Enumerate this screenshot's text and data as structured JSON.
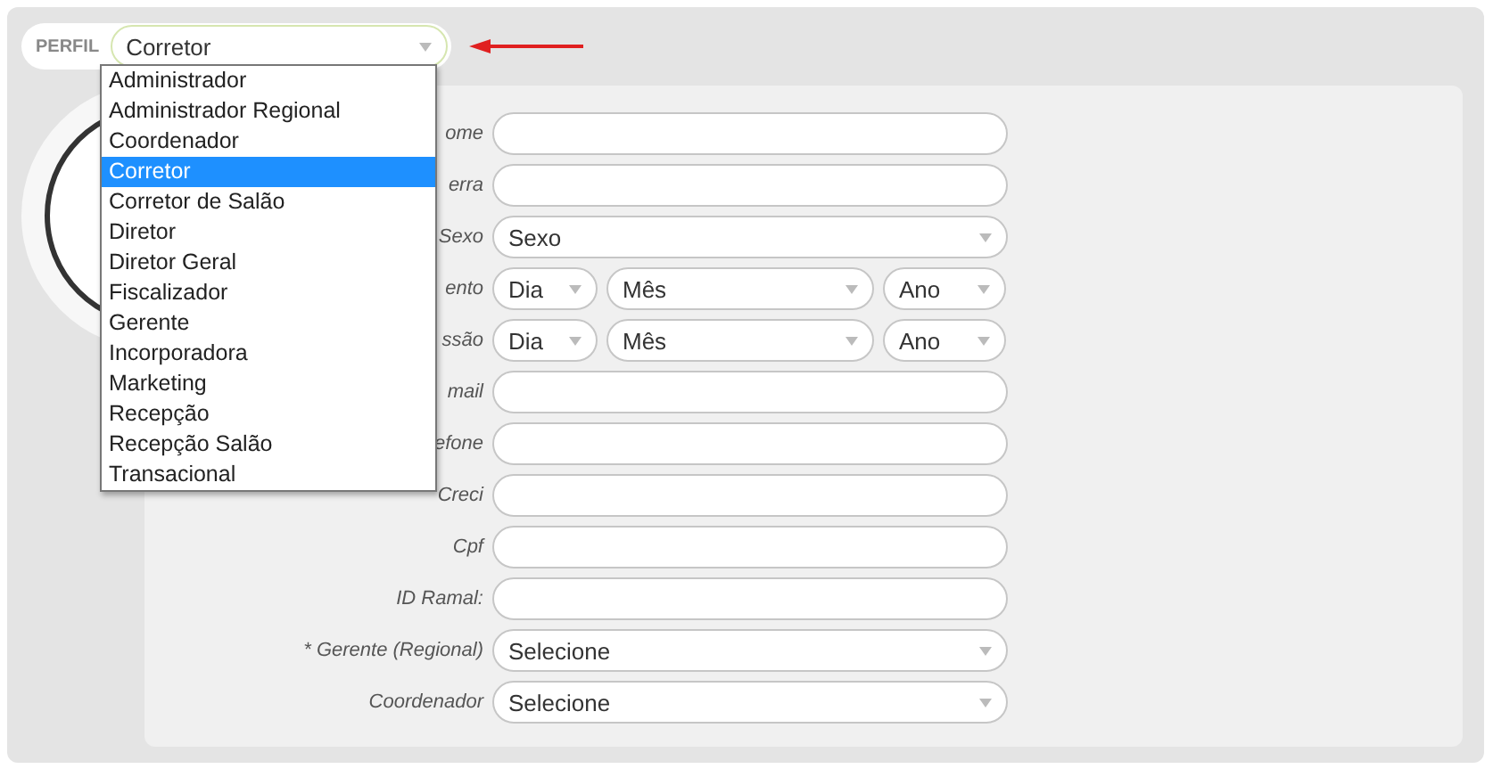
{
  "perfil": {
    "label": "PERFIL",
    "value": "Corretor",
    "open": true,
    "options": [
      {
        "label": "Administrador",
        "selected": false
      },
      {
        "label": "Administrador Regional",
        "selected": false
      },
      {
        "label": "Coordenador",
        "selected": false
      },
      {
        "label": "Corretor",
        "selected": true
      },
      {
        "label": "Corretor de Salão",
        "selected": false
      },
      {
        "label": "Diretor",
        "selected": false
      },
      {
        "label": "Diretor Geral",
        "selected": false
      },
      {
        "label": "Fiscalizador",
        "selected": false
      },
      {
        "label": "Gerente",
        "selected": false
      },
      {
        "label": "Incorporadora",
        "selected": false
      },
      {
        "label": "Marketing",
        "selected": false
      },
      {
        "label": "Recepção",
        "selected": false
      },
      {
        "label": "Recepção Salão",
        "selected": false
      },
      {
        "label": "Transacional",
        "selected": false
      }
    ]
  },
  "form": {
    "rows": [
      {
        "label": "ome",
        "kind": "text"
      },
      {
        "label": "erra",
        "kind": "text"
      },
      {
        "label": "Sexo",
        "kind": "select",
        "value": "Sexo"
      },
      {
        "label": "ento",
        "kind": "date",
        "parts": [
          "Dia",
          "Mês",
          "Ano"
        ]
      },
      {
        "label": "ssão",
        "kind": "date",
        "parts": [
          "Dia",
          "Mês",
          "Ano"
        ]
      },
      {
        "label": "mail",
        "kind": "text"
      },
      {
        "label": "efone",
        "kind": "text"
      },
      {
        "label": "Creci",
        "kind": "text"
      },
      {
        "label": "Cpf",
        "kind": "text"
      },
      {
        "label": "ID Ramal:",
        "kind": "text"
      },
      {
        "label": "* Gerente (Regional)",
        "kind": "select",
        "value": "Selecione"
      },
      {
        "label": "Coordenador",
        "kind": "select",
        "value": "Selecione"
      }
    ]
  }
}
